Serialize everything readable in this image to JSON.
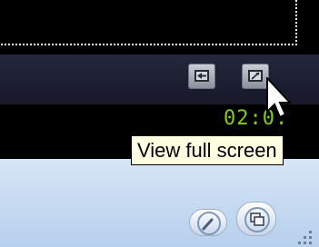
{
  "tooltip": {
    "text": "View full screen"
  },
  "player": {
    "time": "02:0:"
  },
  "icons": {
    "prev": "previous-frame-icon",
    "fullscreen": "fullscreen-icon",
    "brush": "brush-icon",
    "restore": "restore-icon"
  }
}
